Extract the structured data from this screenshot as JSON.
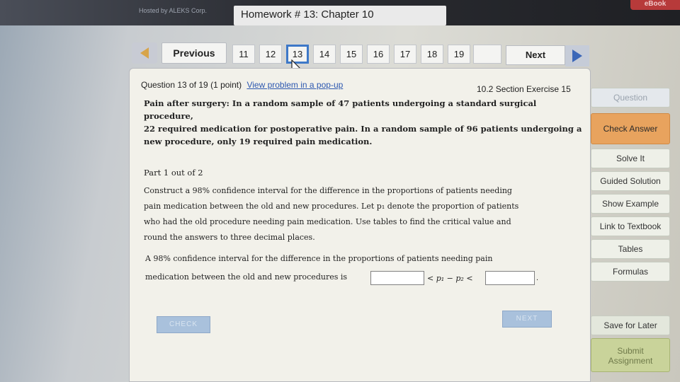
{
  "header": {
    "hosted_by": "Hosted by ALEKS Corp.",
    "title": "Homework # 13: Chapter 10",
    "ebook": "eBook"
  },
  "nav": {
    "previous_label": "Previous",
    "next_label": "Next",
    "question_numbers": [
      "11",
      "12",
      "13",
      "14",
      "15",
      "16",
      "17",
      "18",
      "19"
    ],
    "current": "13"
  },
  "question": {
    "header": "Question 13 of 19 (1 point)",
    "popup_link": "View problem in a pop-up",
    "section_exercise": "10.2 Section Exercise 15",
    "problem_lines": [
      "Pain after surgery: In a random sample of 47 patients undergoing a standard surgical procedure,",
      "22 required medication for postoperative pain. In a random sample of 96 patients undergoing a",
      "new procedure, only 19 required pain medication."
    ],
    "part": "Part 1 out of 2",
    "instruction_lines": [
      "Construct a 98% confidence interval for the difference in the proportions of patients needing",
      "pain medication between the old and new procedures. Let p₁ denote the proportion of patients",
      "who had the old procedure needing pain medication. Use tables to find the critical value and",
      "round the answers to three decimal places."
    ],
    "answer_line1": "A 98% confidence interval for the difference in the proportions of patients needing pain",
    "answer_line2": "medication between the old and new procedures is",
    "inequality": "< p₁ − p₂ <",
    "period": ".",
    "check_label": "CHECK",
    "next_small_label": "NEXT"
  },
  "sidebar": {
    "question": "Question",
    "check_answer": "Check Answer",
    "solve_it": "Solve It",
    "guided_solution": "Guided Solution",
    "show_example": "Show Example",
    "link_to_textbook": "Link to Textbook",
    "tables": "Tables",
    "formulas": "Formulas",
    "save_for_later": "Save for Later",
    "submit_line1": "Submit",
    "submit_line2": "Assignment"
  }
}
